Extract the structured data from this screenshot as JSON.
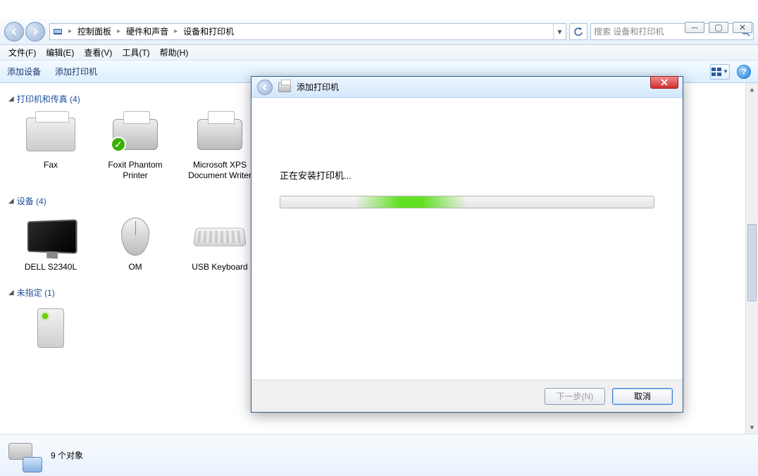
{
  "window": {
    "minimize": "─",
    "maximize": "▢",
    "close": "✕"
  },
  "breadcrumb": {
    "root": "控制面板",
    "mid": "硬件和声音",
    "leaf": "设备和打印机"
  },
  "search": {
    "placeholder": "搜索 设备和打印机"
  },
  "menu": {
    "file": "文件(F)",
    "edit": "编辑(E)",
    "view": "查看(V)",
    "tools": "工具(T)",
    "help": "帮助(H)"
  },
  "toolbar": {
    "add_device": "添加设备",
    "add_printer": "添加打印机"
  },
  "groups": {
    "printers": {
      "title": "打印机和传真 (4)",
      "items": [
        {
          "name": "Fax",
          "icon": "fax"
        },
        {
          "name": "Foxit Phantom Printer",
          "icon": "printer",
          "default": true
        },
        {
          "name": "Microsoft XPS Document Writer",
          "icon": "printer"
        }
      ]
    },
    "devices": {
      "title": "设备 (4)",
      "items": [
        {
          "name": "DELL S2340L",
          "icon": "monitor"
        },
        {
          "name": "OM",
          "icon": "mouse"
        },
        {
          "name": "USB Keyboard",
          "icon": "keyboard"
        }
      ]
    },
    "unspecified": {
      "title": "未指定 (1)",
      "items": [
        {
          "name": "",
          "icon": "server"
        }
      ]
    }
  },
  "status": {
    "count_label": "9 个对象"
  },
  "dialog": {
    "title": "添加打印机",
    "message": "正在安装打印机...",
    "next": "下一步(N)",
    "cancel": "取消"
  }
}
